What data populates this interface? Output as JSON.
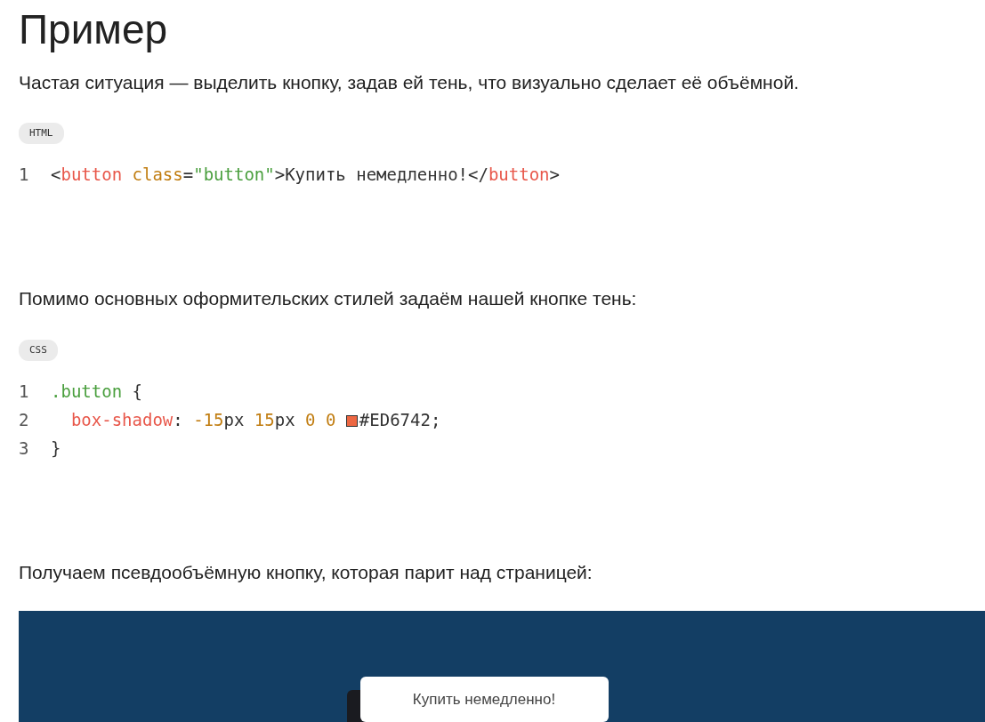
{
  "title": "Пример",
  "blocks": [
    {
      "kind": "text",
      "text": "Частая ситуация — выделить кнопку, задав ей тень, что визуально сделает её объёмной."
    },
    {
      "kind": "code",
      "language": "HTML",
      "lines": [
        {
          "number": "1",
          "tokens": [
            {
              "kind": "punct",
              "text": "<"
            },
            {
              "kind": "tag",
              "text": "button"
            },
            {
              "kind": "attr",
              "text": " class"
            },
            {
              "kind": "punct",
              "text": "="
            },
            {
              "kind": "string",
              "text": "\"button\""
            },
            {
              "kind": "punct",
              "text": ">Купить немедленно!</"
            },
            {
              "kind": "tag",
              "text": "button"
            },
            {
              "kind": "punct",
              "text": ">"
            }
          ]
        }
      ]
    },
    {
      "kind": "text",
      "text": "Помимо основных оформительских стилей задаём нашей кнопке тень:"
    },
    {
      "kind": "code",
      "language": "CSS",
      "lines": [
        {
          "number": "1",
          "tokens": [
            {
              "kind": "selector",
              "text": ".button"
            },
            {
              "kind": "punct",
              "text": " {"
            }
          ]
        },
        {
          "number": "2",
          "tokens": [
            {
              "kind": "property",
              "text": "  box-shadow"
            },
            {
              "kind": "punct",
              "text": ": "
            },
            {
              "kind": "number",
              "text": "-15"
            },
            {
              "kind": "punct",
              "text": "px "
            },
            {
              "kind": "number",
              "text": "15"
            },
            {
              "kind": "punct",
              "text": "px "
            },
            {
              "kind": "number",
              "text": "0 0 "
            },
            {
              "kind": "swatch",
              "color": "#ed6742"
            },
            {
              "kind": "punct",
              "text": "#ED6742;"
            }
          ]
        },
        {
          "number": "3",
          "tokens": [
            {
              "kind": "punct",
              "text": "}"
            }
          ]
        }
      ]
    },
    {
      "kind": "text",
      "text": "Получаем псевдообъёмную кнопку, которая парит над страницей:"
    },
    {
      "kind": "demo",
      "button": "Купить немедленно!"
    }
  ]
}
